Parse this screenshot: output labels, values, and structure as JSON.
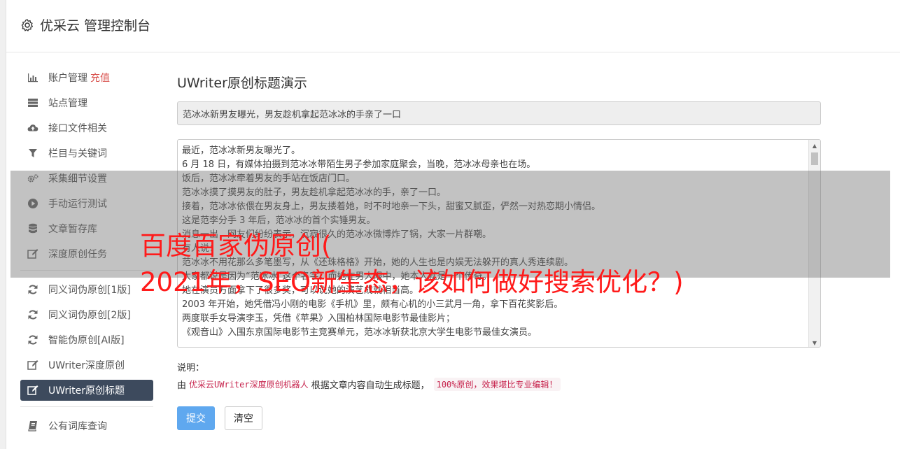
{
  "header": {
    "title": "优采云 管理控制台"
  },
  "sidebar": {
    "items": [
      {
        "label": "账户管理",
        "extra": "充值",
        "icon": "bar-chart-icon"
      },
      {
        "label": "站点管理",
        "icon": "server-icon"
      },
      {
        "label": "接口文件相关",
        "icon": "cloud-upload-icon"
      },
      {
        "label": "栏目与关键词",
        "icon": "filter-icon"
      },
      {
        "label": "采集细节设置",
        "icon": "cogs-icon"
      },
      {
        "label": "手动运行测试",
        "icon": "play-circle-icon"
      },
      {
        "label": "文章暂存库",
        "icon": "database-icon"
      },
      {
        "label": "深度原创任务",
        "icon": "edit-icon"
      }
    ],
    "items2": [
      {
        "label": "同义词伪原创[1版]",
        "icon": "refresh-icon"
      },
      {
        "label": "同义词伪原创[2版]",
        "icon": "refresh-icon"
      },
      {
        "label": "智能伪原创[AI版]",
        "icon": "refresh-icon"
      },
      {
        "label": "UWriter深度原创",
        "icon": "edit-icon"
      },
      {
        "label": "UWriter原创标题",
        "icon": "edit-icon",
        "active": true
      }
    ],
    "items3": [
      {
        "label": "公有词库查询",
        "icon": "book-icon"
      }
    ]
  },
  "main": {
    "title": "UWriter原创标题演示",
    "title_value": "范冰冰新男友曝光，男友趁机拿起范冰冰的手亲了一口",
    "content_lines": [
      "最近，范冰冰新男友曝光了。",
      "6 月 18 日，有媒体拍摄到范冰冰带陌生男子参加家庭聚会，当晚，范冰冰母亲也在场。",
      "饭后，范冰冰牵着男友的手站在饭店门口。",
      "范冰冰摸了摸男友的肚子，男友趁机拿起范冰冰的手，亲了一口。",
      "接着，范冰冰依偎在男友身上，男友搂着她，时不时地亲一下头，甜蜜又腻歪，俨然一对热恋期小情侣。",
      "这是范李分手 3 年后，范冰冰的首个实锤男友。",
      "消息一出，网友们纷纷表示，沉寂很久的范冰冰微博炸了锅，大家一片群嘲。",
      "有人说：",
      "范冰冰不用花那么多笔墨写，从《还珠格格》开始，她的人生也是内娱无法躲开的真人秀连续剧。",
      "大家都说是因为“范冰冰”这个名字，而她在男人眼中，她本人就是一个传奇。",
      "她在演员方面拿下了很多奖，可以说她的演艺成就相当高。",
      "2003 年开始，她凭借冯小刚的电影《手机》里，颇有心机的小三武月一角，拿下百花奖影后。",
      "两度联手女导演李玉，凭借《苹果》入围柏林国际电影节最佳影片；",
      "《观音山》入围东京国际电影节主竞赛单元，范冰冰斩获北京大学生电影节最佳女演员。"
    ],
    "note_label": "说明：",
    "note_prefix": "由",
    "note_code1": "优采云UWriter深度原创机器人",
    "note_mid": "根据文章内容自动生成标题，",
    "note_code2": "100%原创，效果堪比专业编辑！",
    "submit_label": "提交",
    "clear_label": "清空"
  },
  "overlay": {
    "line1": "百度百家伪原创(",
    "line2": "2021年，SEO新生态，该如何做好搜索优化？)"
  }
}
